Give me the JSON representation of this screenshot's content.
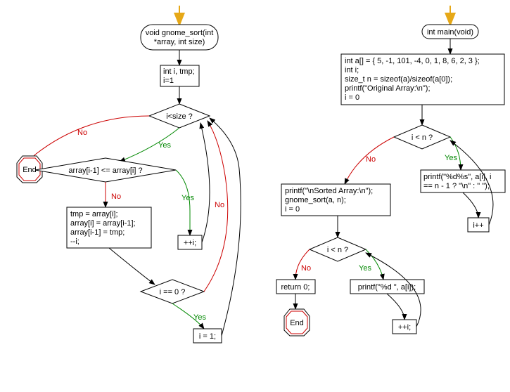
{
  "chart_data": [
    {
      "type": "flowchart",
      "title": "gnome_sort",
      "nodes": {
        "start_arrow": {
          "kind": "entry"
        },
        "func_sig": {
          "kind": "terminator",
          "text": "void gnome_sort(int *array, int size)"
        },
        "init": {
          "kind": "process",
          "text": "int i, tmp;\ni=1"
        },
        "cond_size": {
          "kind": "decision",
          "text": "i<size ?"
        },
        "end": {
          "kind": "end",
          "text": "End"
        },
        "cond_cmp": {
          "kind": "decision",
          "text": "array[i-1] <= array[i] ?"
        },
        "inc_i": {
          "kind": "process",
          "text": "++i;"
        },
        "swap": {
          "kind": "process",
          "text": "tmp = array[i];\narray[i] = array[i-1];\narray[i-1] = tmp;\n--i;"
        },
        "cond_zero": {
          "kind": "decision",
          "text": "i == 0 ?"
        },
        "set_one": {
          "kind": "process",
          "text": "i = 1;"
        }
      },
      "edges": [
        {
          "from": "start_arrow",
          "to": "func_sig"
        },
        {
          "from": "func_sig",
          "to": "init"
        },
        {
          "from": "init",
          "to": "cond_size"
        },
        {
          "from": "cond_size",
          "to": "end",
          "label": "No"
        },
        {
          "from": "cond_size",
          "to": "cond_cmp",
          "label": "Yes"
        },
        {
          "from": "cond_cmp",
          "to": "inc_i",
          "label": "Yes"
        },
        {
          "from": "cond_cmp",
          "to": "swap",
          "label": "No"
        },
        {
          "from": "inc_i",
          "to": "cond_size"
        },
        {
          "from": "swap",
          "to": "cond_zero"
        },
        {
          "from": "cond_zero",
          "to": "cond_size",
          "label": "No"
        },
        {
          "from": "cond_zero",
          "to": "set_one",
          "label": "Yes"
        },
        {
          "from": "set_one",
          "to": "cond_size"
        }
      ]
    },
    {
      "type": "flowchart",
      "title": "main",
      "nodes": {
        "start_arrow": {
          "kind": "entry"
        },
        "main_sig": {
          "kind": "terminator",
          "text": "int main(void)"
        },
        "main_init": {
          "kind": "process",
          "text": "int a[] = { 5, -1, 101, -4, 0, 1, 8, 6, 2, 3 };\nint i;\nsize_t n = sizeof(a)/sizeof(a[0]);\nprintf(\"Original Array:\\n\");\ni = 0"
        },
        "cond1": {
          "kind": "decision",
          "text": "i < n ?"
        },
        "print1": {
          "kind": "process",
          "text": "printf(\"%d%s\", a[i], i == n - 1 ? \"\\n\" : \" \");"
        },
        "inc1": {
          "kind": "process",
          "text": "i++"
        },
        "sorted_block": {
          "kind": "process",
          "text": "printf(\"\\nSorted Array:\\n\");\ngnome_sort(a, n);\ni = 0"
        },
        "cond2": {
          "kind": "decision",
          "text": "i < n ?"
        },
        "print2": {
          "kind": "process",
          "text": "printf(\"%d \", a[i]);"
        },
        "inc2": {
          "kind": "process",
          "text": "++i;"
        },
        "ret": {
          "kind": "process",
          "text": "return 0;"
        },
        "end": {
          "kind": "end",
          "text": "End"
        }
      },
      "edges": [
        {
          "from": "start_arrow",
          "to": "main_sig"
        },
        {
          "from": "main_sig",
          "to": "main_init"
        },
        {
          "from": "main_init",
          "to": "cond1"
        },
        {
          "from": "cond1",
          "to": "print1",
          "label": "Yes"
        },
        {
          "from": "print1",
          "to": "inc1"
        },
        {
          "from": "inc1",
          "to": "cond1"
        },
        {
          "from": "cond1",
          "to": "sorted_block",
          "label": "No"
        },
        {
          "from": "sorted_block",
          "to": "cond2"
        },
        {
          "from": "cond2",
          "to": "print2",
          "label": "Yes"
        },
        {
          "from": "print2",
          "to": "inc2"
        },
        {
          "from": "inc2",
          "to": "cond2"
        },
        {
          "from": "cond2",
          "to": "ret",
          "label": "No"
        },
        {
          "from": "ret",
          "to": "end"
        }
      ]
    }
  ],
  "labels": {
    "yes": "Yes",
    "no": "No",
    "end": "End"
  },
  "colors": {
    "yes": "#008800",
    "no": "#cc0000",
    "stroke": "#000000",
    "entry_arrow": "#e6a817"
  },
  "left": {
    "func_sig_l1": "void gnome_sort(int",
    "func_sig_l2": "*array, int size)",
    "init_l1": "int i, tmp;",
    "init_l2": "i=1",
    "cond_size": "i<size ?",
    "cond_cmp": "array[i-1] <= array[i] ?",
    "swap_l1": "tmp = array[i];",
    "swap_l2": "array[i] = array[i-1];",
    "swap_l3": "array[i-1] = tmp;",
    "swap_l4": "--i;",
    "inc_i": "++i;",
    "cond_zero": "i == 0 ?",
    "set_one": "i = 1;"
  },
  "right": {
    "main_sig": "int main(void)",
    "init_l1": "int a[] = { 5, -1, 101, -4, 0, 1, 8, 6, 2, 3 };",
    "init_l2": "int i;",
    "init_l3": "size_t n = sizeof(a)/sizeof(a[0]);",
    "init_l4": "printf(\"Original Array:\\n\");",
    "init_l5": "i = 0",
    "cond1": "i < n ?",
    "print1_l1": "printf(\"%d%s\", a[i], i",
    "print1_l2": "== n - 1 ? \"\\n\" : \" \");",
    "inc1": "i++",
    "sorted_l1": "printf(\"\\nSorted Array:\\n\");",
    "sorted_l2": "gnome_sort(a, n);",
    "sorted_l3": "i = 0",
    "cond2": "i < n ?",
    "print2": "printf(\"%d \", a[i]);",
    "inc2": "++i;",
    "ret": "return 0;"
  }
}
